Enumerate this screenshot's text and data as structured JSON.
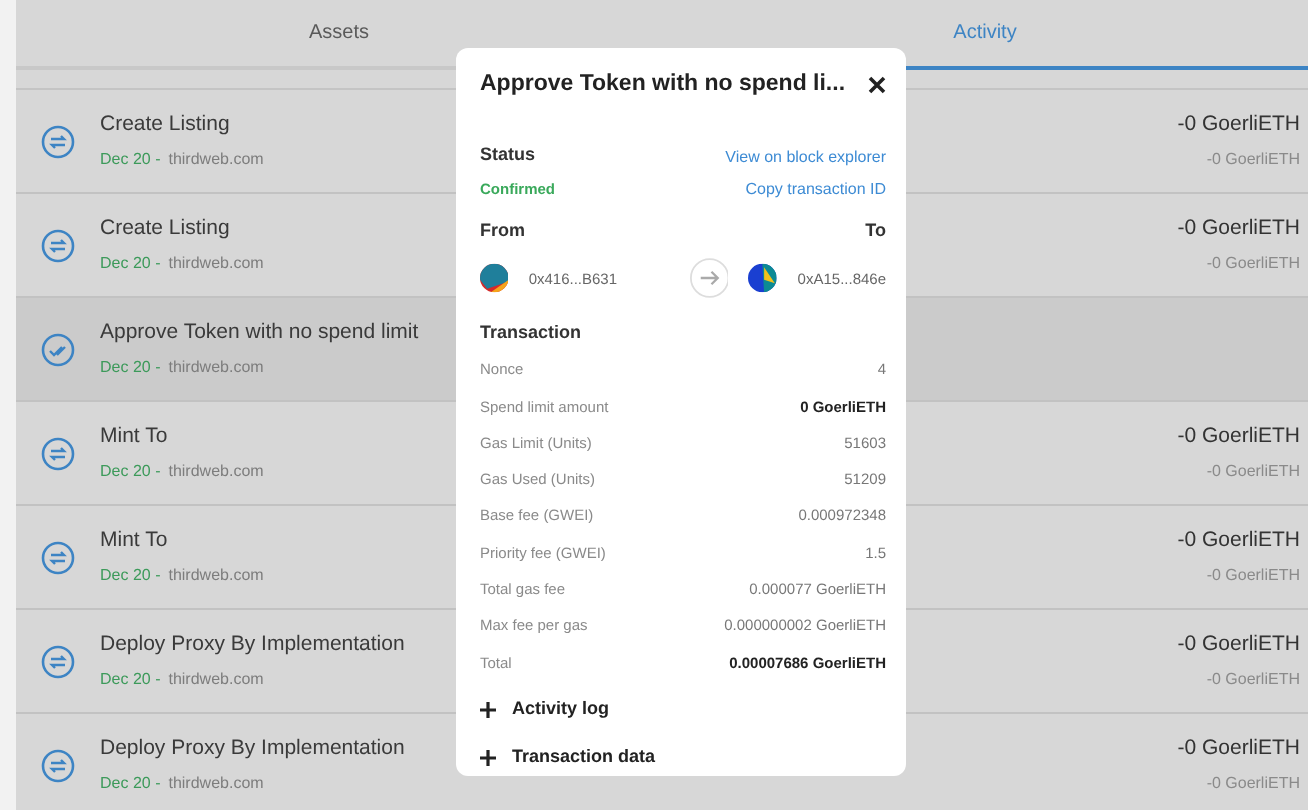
{
  "tabs": [
    {
      "label": "Assets",
      "selected": false
    },
    {
      "label": "Activity",
      "selected": true
    }
  ],
  "activity": [
    {
      "kind": "interaction",
      "title": "Create Listing",
      "date": "Dec 20 -",
      "origin": "thirdweb.com",
      "amount": "-0 GoerliETH",
      "amount_secondary": "-0 GoerliETH",
      "selected": false
    },
    {
      "kind": "interaction",
      "title": "Create Listing",
      "date": "Dec 20 -",
      "origin": "thirdweb.com",
      "amount": "-0 GoerliETH",
      "amount_secondary": "-0 GoerliETH",
      "selected": false
    },
    {
      "kind": "approve",
      "title": "Approve Token with no spend limit",
      "date": "Dec 20 -",
      "origin": "thirdweb.com",
      "selected": true
    },
    {
      "kind": "interaction",
      "title": "Mint To",
      "date": "Dec 20 -",
      "origin": "thirdweb.com",
      "amount": "-0 GoerliETH",
      "amount_secondary": "-0 GoerliETH",
      "selected": false
    },
    {
      "kind": "interaction",
      "title": "Mint To",
      "date": "Dec 20 -",
      "origin": "thirdweb.com",
      "amount": "-0 GoerliETH",
      "amount_secondary": "-0 GoerliETH",
      "selected": false
    },
    {
      "kind": "interaction",
      "title": "Deploy Proxy By Implementation",
      "date": "Dec 20 -",
      "origin": "thirdweb.com",
      "amount": "-0 GoerliETH",
      "amount_secondary": "-0 GoerliETH",
      "selected": false
    },
    {
      "kind": "interaction",
      "title": "Deploy Proxy By Implementation",
      "date": "Dec 20 -",
      "origin": "thirdweb.com",
      "amount": "-0 GoerliETH",
      "amount_secondary": "-0 GoerliETH",
      "selected": false
    }
  ],
  "details": {
    "title": "Approve Token with no spend li...",
    "status_label": "Status",
    "status": "Confirmed",
    "links": [
      "View on block explorer",
      "Copy transaction ID"
    ],
    "from_label": "From",
    "to_label": "To",
    "from_address": "0x416...B631",
    "to_address": "0xA15...846e",
    "transaction_label": "Transaction",
    "rows": [
      {
        "label": "Nonce",
        "value": "4",
        "bold": false
      },
      {
        "label": "Spend limit amount",
        "value": "0 GoerliETH",
        "bold": true
      },
      {
        "label": "Gas Limit (Units)",
        "value": "51603",
        "bold": false
      },
      {
        "label": "Gas Used (Units)",
        "value": "51209",
        "bold": false
      },
      {
        "label": "Base fee (GWEI)",
        "value": "0.000972348",
        "bold": false
      },
      {
        "label": "Priority fee (GWEI)",
        "value": "1.5",
        "bold": false
      },
      {
        "label": "Total gas fee",
        "value": "0.000077 GoerliETH",
        "bold": false
      },
      {
        "label": "Max fee per gas",
        "value": "0.000000002 GoerliETH",
        "bold": false
      },
      {
        "label": "Total",
        "value": "0.00007686 GoerliETH",
        "bold": true
      }
    ],
    "sections": [
      {
        "label": "Activity log",
        "expanded": false
      },
      {
        "label": "Transaction data",
        "expanded": false
      }
    ]
  }
}
